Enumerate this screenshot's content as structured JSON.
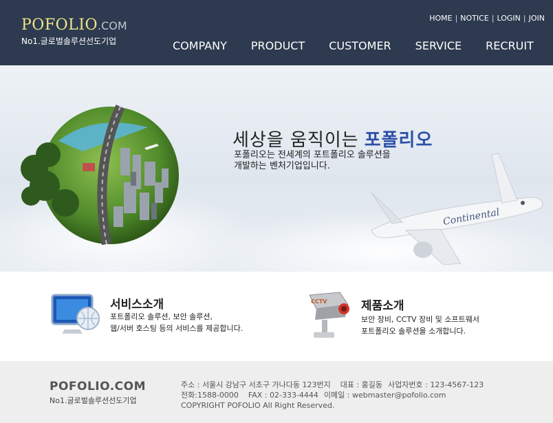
{
  "header": {
    "logo_main": "POFOLIO",
    "logo_com": ".COM",
    "logo_sub": "No1.글로벌솔루션선도기업",
    "util_links": [
      "HOME",
      "NOTICE",
      "LOGIN",
      "JOIN"
    ],
    "util_sep": "|",
    "nav": [
      "COMPANY",
      "PRODUCT",
      "CUSTOMER",
      "SERVICE",
      "RECRUIT"
    ],
    "colors": {
      "bg": "#2d3a4f",
      "logo": "#f0e68c"
    }
  },
  "hero": {
    "title": "세상을 움직이는",
    "brand": "포폴리오",
    "desc_line1": "포폴리오는 전세계의 포트폴리오 솔루션을",
    "desc_line2": "개발하는 벤처기업입니다.",
    "plane_text": "Continental",
    "brand_color": "#2d4fa7"
  },
  "services": [
    {
      "title": "서비스소개",
      "line1": "포트폴리오 솔루션, 보안 솔루션,",
      "line2": "웹/서버 호스팅 등의 서비스를 제공합니다.",
      "icon": "monitor-globe-icon"
    },
    {
      "title": "제품소개",
      "line1": "보안 장비, CCTV 장비 및 소프트웨서",
      "line2": "포트폴리오 솔루션을 소개합니다.",
      "icon": "cctv-camera-icon",
      "icon_label": "CCTV"
    }
  ],
  "footer": {
    "logo": "POFOLIO.COM",
    "sub": "No1.글로벌솔루션선도기업",
    "address": "주소 : 서울시 강남구 서초구 가나다동 123번지",
    "ceo": "대표 : 홍길동",
    "bizno": "사업자번호 : 123-4567-123",
    "tel": "전화:1588-0000",
    "fax": "FAX : 02-333-4444",
    "email": "이메일 : webmaster@pofolio.com",
    "copyright": "COPYRIGHT POFOLIO All Right Reserved."
  }
}
